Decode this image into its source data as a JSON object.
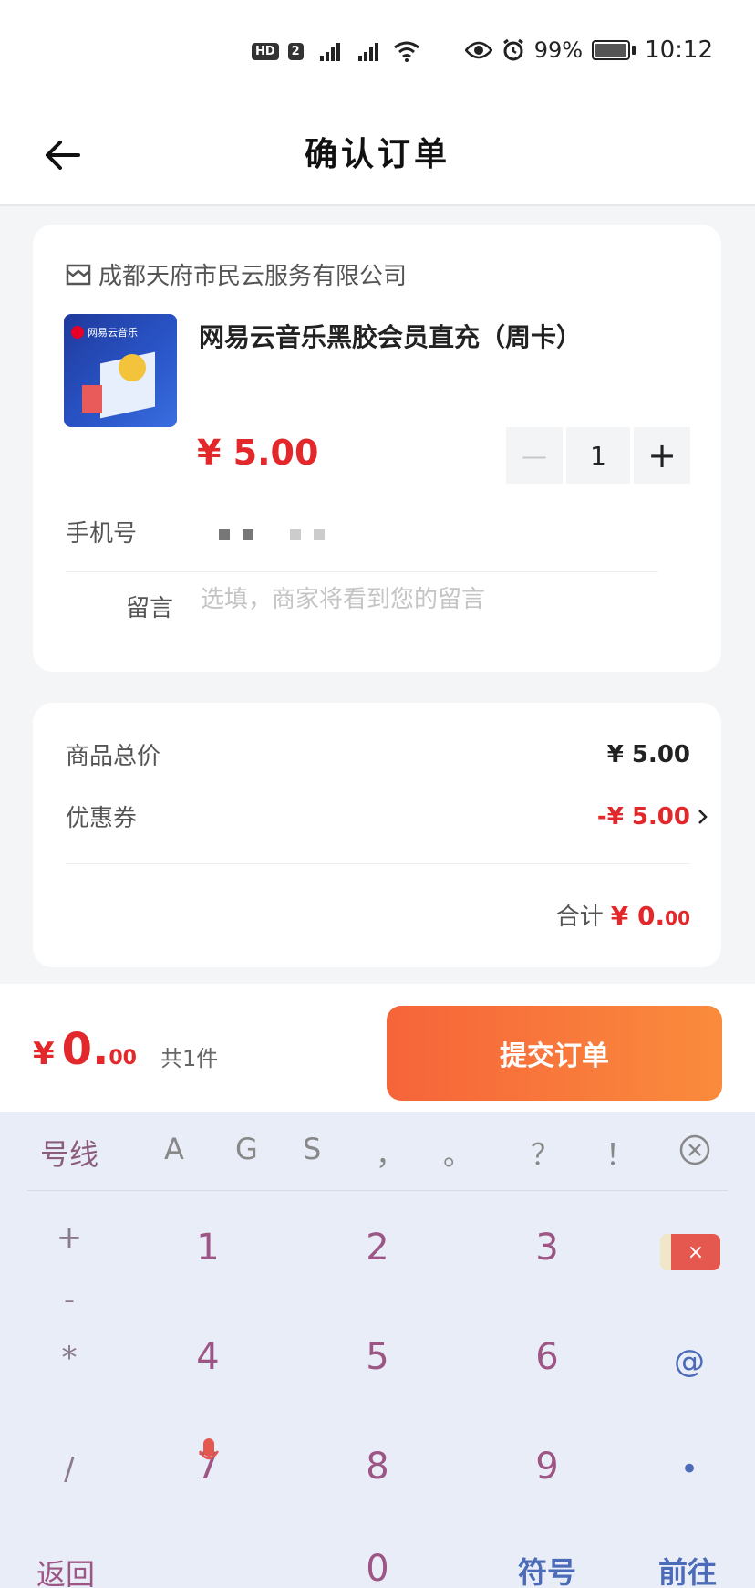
{
  "status_bar": {
    "hd": "HD",
    "sim": "2",
    "net1": "2G",
    "net2": "5G",
    "battery": "99%",
    "time": "10:12"
  },
  "nav": {
    "title": "确认订单",
    "back_icon": "arrow-left-icon"
  },
  "order": {
    "shop_name": "成都天府市民云服务有限公司",
    "product_logo_text": "网易云音乐",
    "product_title": "网易云音乐黑胶会员直充（周卡）",
    "price": "¥ 5.00",
    "quantity": "1",
    "minus_label": "—",
    "plus_label": "+",
    "phone_label": "手机号",
    "message_label": "留言",
    "message_placeholder": "选填，商家将看到您的留言"
  },
  "summary": {
    "goods_total_label": "商品总价",
    "goods_total_value": "¥ 5.00",
    "coupon_label": "优惠券",
    "coupon_value": "-¥ 5.00",
    "total_label": "合计",
    "total_yen": "¥ 0.",
    "total_dec": "00"
  },
  "submit_bar": {
    "yen": "¥",
    "amount_int": "0.",
    "amount_dec": "00",
    "count": "共1件",
    "submit_label": "提交订单"
  },
  "keyboard": {
    "top_row": [
      "号线",
      "A",
      "G",
      "S",
      "，",
      "。",
      "？",
      "！"
    ],
    "symbols_col": [
      "+",
      "-",
      "*",
      "/"
    ],
    "digits": [
      "1",
      "2",
      "3",
      "4",
      "5",
      "6",
      "7",
      "8",
      "9",
      "0"
    ],
    "at": "@",
    "dot": "•",
    "back": "返回",
    "symbols_key": "符号",
    "go_key": "前往",
    "delete_label": "×"
  },
  "colors": {
    "accent_red": "#e3282c",
    "submit_gradient_start": "#f6643a",
    "submit_gradient_end": "#fa8b3c",
    "keyboard_bg": "#e9edf8"
  }
}
